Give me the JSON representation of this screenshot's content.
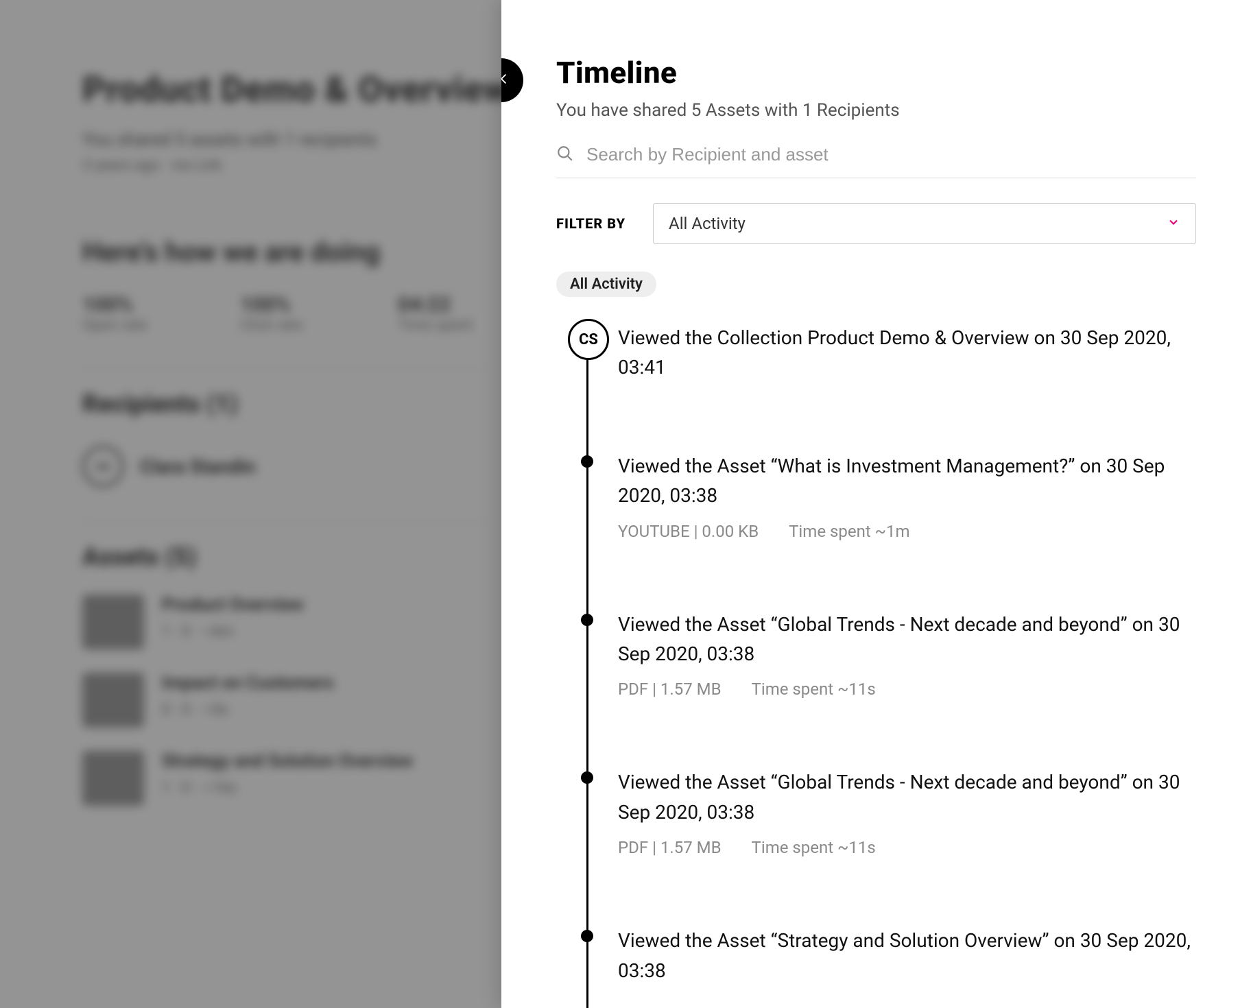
{
  "background": {
    "title": "Product Demo & Overview",
    "subtitle": "You shared 5 assets with 1 recipients",
    "subtitle2": "3 years ago · via Link",
    "doing_heading": "Here's how we are doing",
    "stats": [
      {
        "value": "100%",
        "label": "Open rate"
      },
      {
        "value": "100%",
        "label": "Click rate"
      },
      {
        "value": "04:22",
        "label": "Time spent"
      }
    ],
    "recipients_heading": "Recipients (1)",
    "recipient": {
      "initials": "CS",
      "name": "Clara Standin"
    },
    "assets_heading": "Assets (5)",
    "assets": [
      {
        "name": "Product Overview",
        "meta": "1 · 0 · ~6m"
      },
      {
        "name": "Impact on Customers",
        "meta": "0 · 0 · ~0s"
      },
      {
        "name": "Strategy and Solution Overview",
        "meta": "1 · 0 · ~16s"
      }
    ]
  },
  "panel": {
    "title": "Timeline",
    "subtitle": "You have shared 5 Assets with 1 Recipients",
    "search": {
      "placeholder": "Search by Recipient and asset",
      "value": ""
    },
    "filter": {
      "label": "FILTER BY",
      "selected": "All Activity"
    },
    "chip": "All Activity",
    "avatar_initials": "CS",
    "entries": [
      {
        "text": "Viewed the Collection Product Demo & Overview on 30 Sep 2020, 03:41",
        "meta1": "",
        "meta2": ""
      },
      {
        "text": "Viewed the Asset “What is Investment Management?” on 30 Sep 2020, 03:38",
        "meta1": "YOUTUBE | 0.00 KB",
        "meta2": "Time spent ~1m"
      },
      {
        "text": "Viewed the Asset “Global Trends - Next decade and beyond” on 30 Sep 2020, 03:38",
        "meta1": "PDF | 1.57 MB",
        "meta2": "Time spent ~11s"
      },
      {
        "text": "Viewed the Asset “Global Trends - Next decade and beyond” on 30 Sep 2020, 03:38",
        "meta1": "PDF | 1.57 MB",
        "meta2": "Time spent ~11s"
      },
      {
        "text": "Viewed the Asset “Strategy and Solution Overview” on 30 Sep 2020, 03:38",
        "meta1": "",
        "meta2": ""
      }
    ]
  }
}
